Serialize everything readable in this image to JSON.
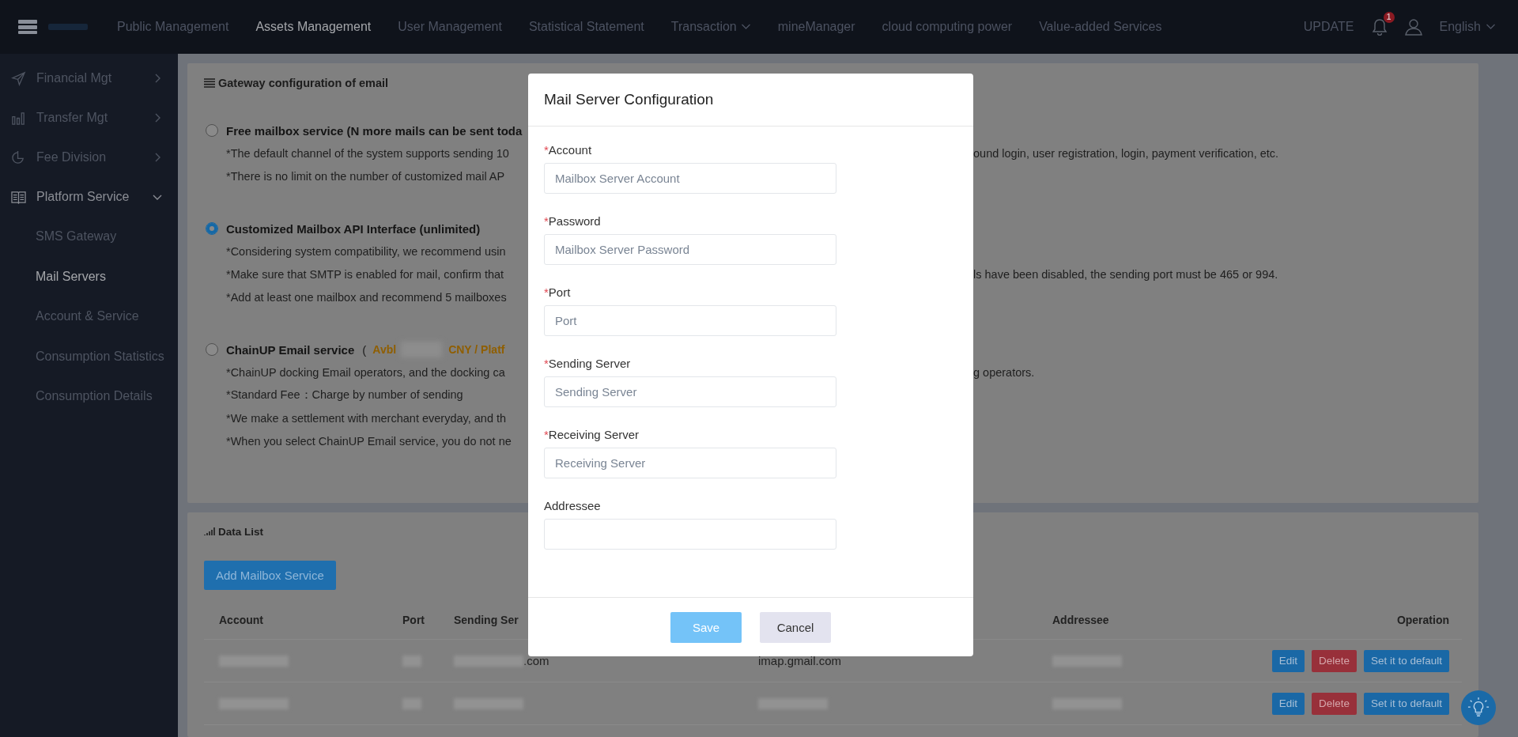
{
  "top_nav": {
    "items": [
      {
        "label": "Public Management",
        "selected": false,
        "dropdown": false
      },
      {
        "label": "Assets Management",
        "selected": true,
        "dropdown": false
      },
      {
        "label": "User Management",
        "selected": false,
        "dropdown": false
      },
      {
        "label": "Statistical Statement",
        "selected": false,
        "dropdown": false
      },
      {
        "label": "Transaction",
        "selected": false,
        "dropdown": true
      },
      {
        "label": "mineManager",
        "selected": false,
        "dropdown": false
      },
      {
        "label": "cloud computing power",
        "selected": false,
        "dropdown": false
      },
      {
        "label": "Value-added Services",
        "selected": false,
        "dropdown": false
      }
    ],
    "update": "UPDATE",
    "notification_count": "1",
    "language": "English"
  },
  "sidebar": {
    "items": [
      {
        "label": "Financial Mgt",
        "expanded": false
      },
      {
        "label": "Transfer Mgt",
        "expanded": false
      },
      {
        "label": "Fee Division",
        "expanded": false
      },
      {
        "label": "Platform Service",
        "expanded": true,
        "children": [
          {
            "label": "SMS Gateway",
            "selected": false
          },
          {
            "label": "Mail Servers",
            "selected": true
          },
          {
            "label": "Account & Service",
            "selected": false
          },
          {
            "label": "Consumption Statistics",
            "selected": false
          },
          {
            "label": "Consumption Details",
            "selected": false
          }
        ]
      }
    ]
  },
  "gateway_card": {
    "title": "Gateway configuration of email",
    "options": [
      {
        "selected": false,
        "title": "Free mailbox service (N more mails can be sent toda",
        "lines": [
          {
            "left": "*The default channel of the system supports sending 10",
            "right": "ound login, user registration, login, payment verification, etc."
          },
          {
            "left": "*There is no limit on the number of customized mail AP"
          }
        ]
      },
      {
        "selected": true,
        "title": "Customized Mailbox API Interface (unlimited)",
        "lines": [
          {
            "left": "*Considering system compatibility, we recommend usin"
          },
          {
            "left": "*Make sure that SMTP is enabled for mail, confirm that",
            "right": "ls have been disabled, the sending port must be 465 or 994."
          },
          {
            "left": "*Add at least one mailbox and recommend 5 mailboxes"
          }
        ]
      },
      {
        "selected": false,
        "title": "ChainUP Email service",
        "paren": "(",
        "balance_label": "Avbl",
        "balance_blurred": true,
        "balance_unit": "CNY / Platf",
        "lines": [
          {
            "left": "*ChainUP docking Email operators, and the docking ca",
            "right": "g operators."
          },
          {
            "left": "*Standard Fee：Charge by number of sending"
          },
          {
            "left": "*We make a settlement with merchant everyday, and th"
          },
          {
            "left": "*When you select ChainUP Email service, you do not ne"
          }
        ]
      }
    ]
  },
  "data_list": {
    "title": "Data List",
    "add_button": "Add Mailbox Service",
    "columns": [
      {
        "label": "Account"
      },
      {
        "label": "Port"
      },
      {
        "label": "Sending Ser"
      },
      {},
      {
        "label": "Addressee"
      },
      {
        "label": "Operation"
      }
    ],
    "rows": [
      {
        "cells": [
          {
            "blurred": true
          },
          {
            "blurred": true
          },
          {
            "blurred": true,
            "text": ".com"
          },
          {
            "blurred": false,
            "text": "imap.gmail.com"
          },
          {
            "blurred": true
          }
        ],
        "actions": [
          "Edit",
          "Delete",
          "Set it to default"
        ]
      },
      {
        "cells": [
          {
            "blurred": true
          },
          {
            "blurred": true
          },
          {
            "blurred": true
          },
          {
            "blurred": true
          },
          {
            "blurred": true
          }
        ],
        "actions": [
          "Edit",
          "Delete",
          "Set it to default"
        ]
      }
    ]
  },
  "modal": {
    "title": "Mail Server Configuration",
    "fields": [
      {
        "label": "Account",
        "marker": "*",
        "placeholder": "Mailbox Server Account"
      },
      {
        "label": "Password",
        "marker": "*",
        "placeholder": "Mailbox Server Password"
      },
      {
        "label": "Port",
        "marker": "*",
        "placeholder": "Port"
      },
      {
        "label": "Sending Server",
        "marker": "*",
        "placeholder": "Sending Server"
      },
      {
        "label": "Receiving Server",
        "marker": "*",
        "placeholder": "Receiving Server"
      },
      {
        "label": "Addressee"
      }
    ],
    "save": "Save",
    "cancel": "Cancel",
    "save_disabled": true
  }
}
